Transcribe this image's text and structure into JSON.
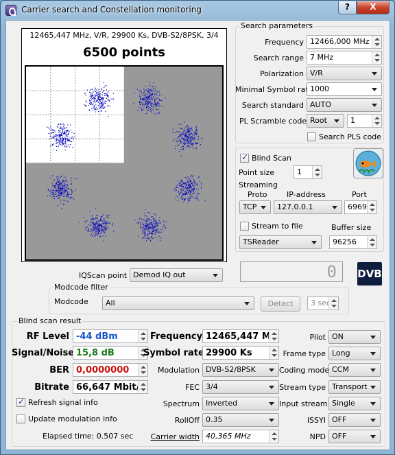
{
  "window": {
    "title": "Carrier search and Constellation monitoring",
    "help_label": "?",
    "close_label": "X"
  },
  "plot": {
    "caption": "12465,447 MHz, V/R, 29900 Ks, DVB-S2/8PSK, 3/4",
    "points_label": "6500 points",
    "point_color": "#1010c0",
    "clusters": 8
  },
  "search": {
    "title": "Search parameters",
    "frequency_label": "Frequency",
    "frequency_value": "12466,000 MHz",
    "range_label": "Search range",
    "range_value": "7 MHz",
    "polarization_label": "Polarization",
    "polarization_value": "V/R",
    "min_sr_label": "Minimal Symbol rate",
    "min_sr_value": "1000",
    "standard_label": "Search standard",
    "standard_value": "AUTO",
    "pls_label": "PL Scramble code",
    "pls_mode": "Root",
    "pls_value": "1",
    "search_pls_label": "Search PLS code"
  },
  "blind": {
    "blind_scan_label": "Blind Scan",
    "point_size_label": "Point size",
    "point_size_value": "1"
  },
  "streaming": {
    "title": "Streaming",
    "proto_label": "Proto",
    "ip_label": "IP-address",
    "port_label": "Port",
    "proto_value": "TCP",
    "ip_value": "127.0.0.1",
    "port_value": "6969",
    "stream_to_file_label": "Stream to file",
    "buffer_label": "Buffer size",
    "reader_value": "TSReader",
    "buffer_value": "96256"
  },
  "iq": {
    "label": "IQScan point",
    "value": "Demod IQ out"
  },
  "counter_value": "0",
  "dvb_logo_text": "DVB",
  "modcode": {
    "title": "Modcode filter",
    "label": "Modcode",
    "value": "All",
    "detect_label": "Detect",
    "interval_value": "3 sec"
  },
  "result": {
    "title": "Blind scan result",
    "rf_label": "RF Level",
    "rf_value": "-44 dBm",
    "rf_color": "#1a56c8",
    "sn_label": "Signal/Noise",
    "sn_value": "15,8 dB",
    "sn_color": "#1a7a1a",
    "ber_label": "BER",
    "ber_value": "0,0000000",
    "ber_color": "#d01010",
    "bitrate_label": "Bitrate",
    "bitrate_value": "66,647 Mbit/s",
    "refresh_label": "Refresh signal info",
    "update_label": "Update modulation info",
    "elapsed_label": "Elapsed time: 0.507 sec",
    "freq_label": "Frequency",
    "freq_value": "12465,447 MHz",
    "sr_label": "Symbol rate",
    "sr_value": "29900 Ks",
    "modulation_label": "Modulation",
    "modulation_value": "DVB-S2/8PSK",
    "fec_label": "FEC",
    "fec_value": "3/4",
    "spectrum_label": "Spectrum",
    "spectrum_value": "Inverted",
    "rolloff_label": "RollOff",
    "rolloff_value": "0.35",
    "carrier_width_label": "Carrier width",
    "carrier_width_value": "40,365 MHz",
    "pilot_label": "Pilot",
    "pilot_value": "ON",
    "frame_label": "Frame type",
    "frame_value": "Long",
    "coding_label": "Coding mode",
    "coding_value": "CCM",
    "stream_type_label": "Stream type",
    "stream_type_value": "Transport",
    "input_stream_label": "Input stream",
    "input_stream_value": "Single",
    "issyi_label": "ISSYI",
    "issyi_value": "OFF",
    "npd_label": "NPD",
    "npd_value": "OFF"
  }
}
